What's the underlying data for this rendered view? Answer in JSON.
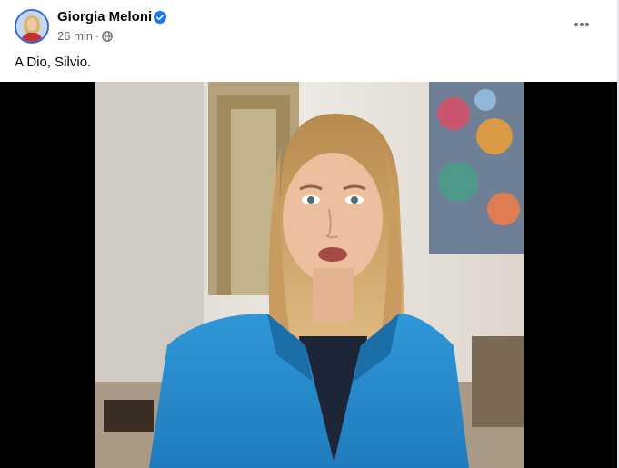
{
  "post": {
    "author": "Giorgia Meloni",
    "time": "26 min",
    "separator": "·",
    "privacy_icon": "globe-icon",
    "verified_icon": "verified-badge-icon",
    "more_icon": "more-options-icon",
    "caption": "A Dio, Silvio."
  },
  "colors": {
    "verified": "#1877f2",
    "jacket": "#2a8fd0",
    "background": "#ffffff",
    "video_letterbox": "#000000"
  }
}
